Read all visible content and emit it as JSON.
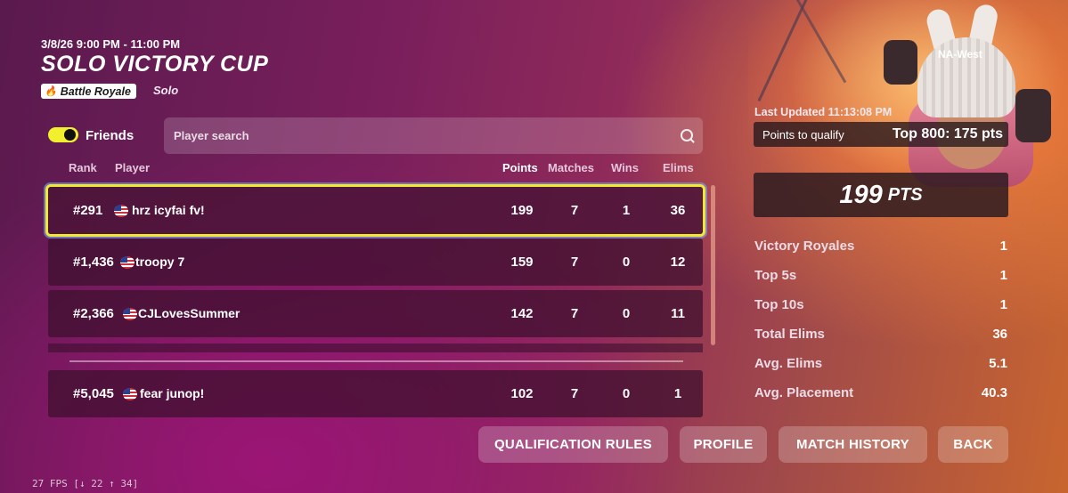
{
  "event": {
    "datetime": "3/8/26 9:00 PM - 11:00 PM",
    "title": "SOLO VICTORY CUP",
    "mode_badge": "Battle Royale",
    "mode_sub": "Solo",
    "mode_icon": "flame-icon"
  },
  "filters": {
    "friends_label": "Friends",
    "friends_on": true,
    "search_placeholder": "Player search"
  },
  "columns": {
    "rank": "Rank",
    "player": "Player",
    "points": "Points",
    "matches": "Matches",
    "wins": "Wins",
    "elims": "Elims"
  },
  "rows": [
    {
      "rank": "#291",
      "player": "hrz icyfai fv!",
      "points": "199",
      "matches": "7",
      "wins": "1",
      "elims": "36",
      "selected": true
    },
    {
      "rank": "#1,436",
      "player": "troopy 7",
      "points": "159",
      "matches": "7",
      "wins": "0",
      "elims": "12"
    },
    {
      "rank": "#2,366",
      "player": "CJLovesSummer",
      "points": "142",
      "matches": "7",
      "wins": "0",
      "elims": "11"
    },
    {
      "rank": "#5,045",
      "player": "fear junop!",
      "points": "102",
      "matches": "7",
      "wins": "0",
      "elims": "1"
    }
  ],
  "side": {
    "region": "NA-West",
    "last_updated": "Last Updated 11:13:08 PM",
    "qualify_label": "Points to qualify",
    "qualify_value": "Top 800: 175 pts",
    "points_big": "199",
    "points_unit": "PTS",
    "stats": [
      {
        "label": "Victory Royales",
        "value": "1"
      },
      {
        "label": "Top 5s",
        "value": "1"
      },
      {
        "label": "Top 10s",
        "value": "1"
      },
      {
        "label": "Total Elims",
        "value": "36"
      },
      {
        "label": "Avg. Elims",
        "value": "5.1"
      },
      {
        "label": "Avg. Placement",
        "value": "40.3"
      }
    ]
  },
  "buttons": {
    "qualification_rules": "QUALIFICATION RULES",
    "profile": "PROFILE",
    "match_history": "MATCH HISTORY",
    "back": "BACK"
  },
  "fps": "27 FPS [↓ 22 ↑ 34]",
  "colors": {
    "accent_yellow": "#f0ea2e"
  }
}
